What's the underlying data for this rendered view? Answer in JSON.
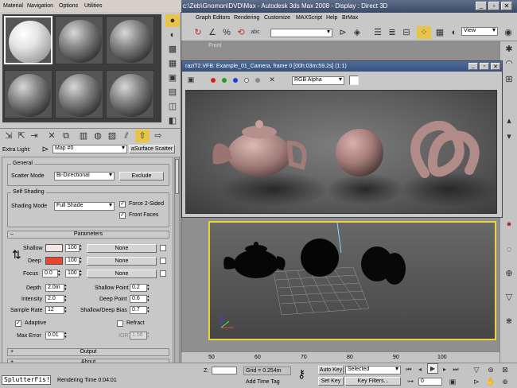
{
  "main_window": {
    "title": "c:\\Zeb\\Gnomon\\DVD\\Max     - Autodesk 3ds Max 2008     - Display : Direct 3D",
    "menu": [
      "Material",
      "Navigation",
      "Options",
      "Utilities",
      "Graph Editors",
      "Rendering",
      "Customize",
      "MAXScript",
      "Help",
      "BrMax"
    ],
    "toolbar": {
      "view_dropdown": "View"
    },
    "viewport_label": "Front"
  },
  "render_window": {
    "title": "raziT2.VFB: Example_01_Camera, frame 0 [00h:03m:59.2s] (1:1)",
    "channel": "RGB Alpha"
  },
  "material_editor": {
    "extra_light_label": "Extra Light:",
    "map_name": "Map #0",
    "map_type": "aSurface Scatter",
    "general": {
      "title": "General",
      "scatter_mode_label": "Scatter Mode",
      "scatter_mode_value": "Bi-Directional",
      "exclude_label": "Exclude"
    },
    "self_shading": {
      "title": "Self Shading",
      "shading_mode_label": "Shading Mode",
      "shading_mode_value": "Full Shade",
      "force_2sided": "Force 2-Sided",
      "front_faces": "Front Faces"
    },
    "parameters": {
      "title": "Parameters",
      "shallow_label": "Shallow",
      "shallow_amount": "100",
      "shallow_map": "None",
      "deep_label": "Deep",
      "deep_amount": "100",
      "deep_map": "None",
      "focus_label": "Focus",
      "focus_value": "0.0",
      "focus_amount": "100",
      "focus_map": "None",
      "depth_label": "Depth",
      "depth_value": "2.0m",
      "shallow_point_label": "Shallow Point",
      "shallow_point_value": "0.2",
      "intensity_label": "Intensity",
      "intensity_value": "2.0",
      "deep_point_label": "Deep Point",
      "deep_point_value": "0.6",
      "sample_rate_label": "Sample Rate",
      "sample_rate_value": "12",
      "bias_label": "Shallow/Deep Bias",
      "bias_value": "0.7",
      "adaptive_label": "Adaptive",
      "refract_label": "Refract",
      "max_error_label": "Max Error",
      "max_error_value": "0.01",
      "ior_label": "IOR",
      "ior_value": "1.56"
    },
    "output_rollout": "Output",
    "about_rollout": "About",
    "colors": {
      "shallow": "#f1e6e3",
      "deep": "#e8462c"
    }
  },
  "status_bar": {
    "script_label": "SplutterFis!",
    "rendering_time": "Rendering Time  0:04:01",
    "z_label": "Z:",
    "grid": "Grid = 0.254m",
    "auto_key": "Auto Key",
    "selected": "Selected",
    "set_key": "Set Key",
    "key_filters": "Key Filters...",
    "add_time_tag": "Add Time Tag",
    "frame_value": "0"
  },
  "timeline": {
    "ticks": [
      "50",
      "60",
      "70",
      "80",
      "90",
      "100"
    ]
  }
}
